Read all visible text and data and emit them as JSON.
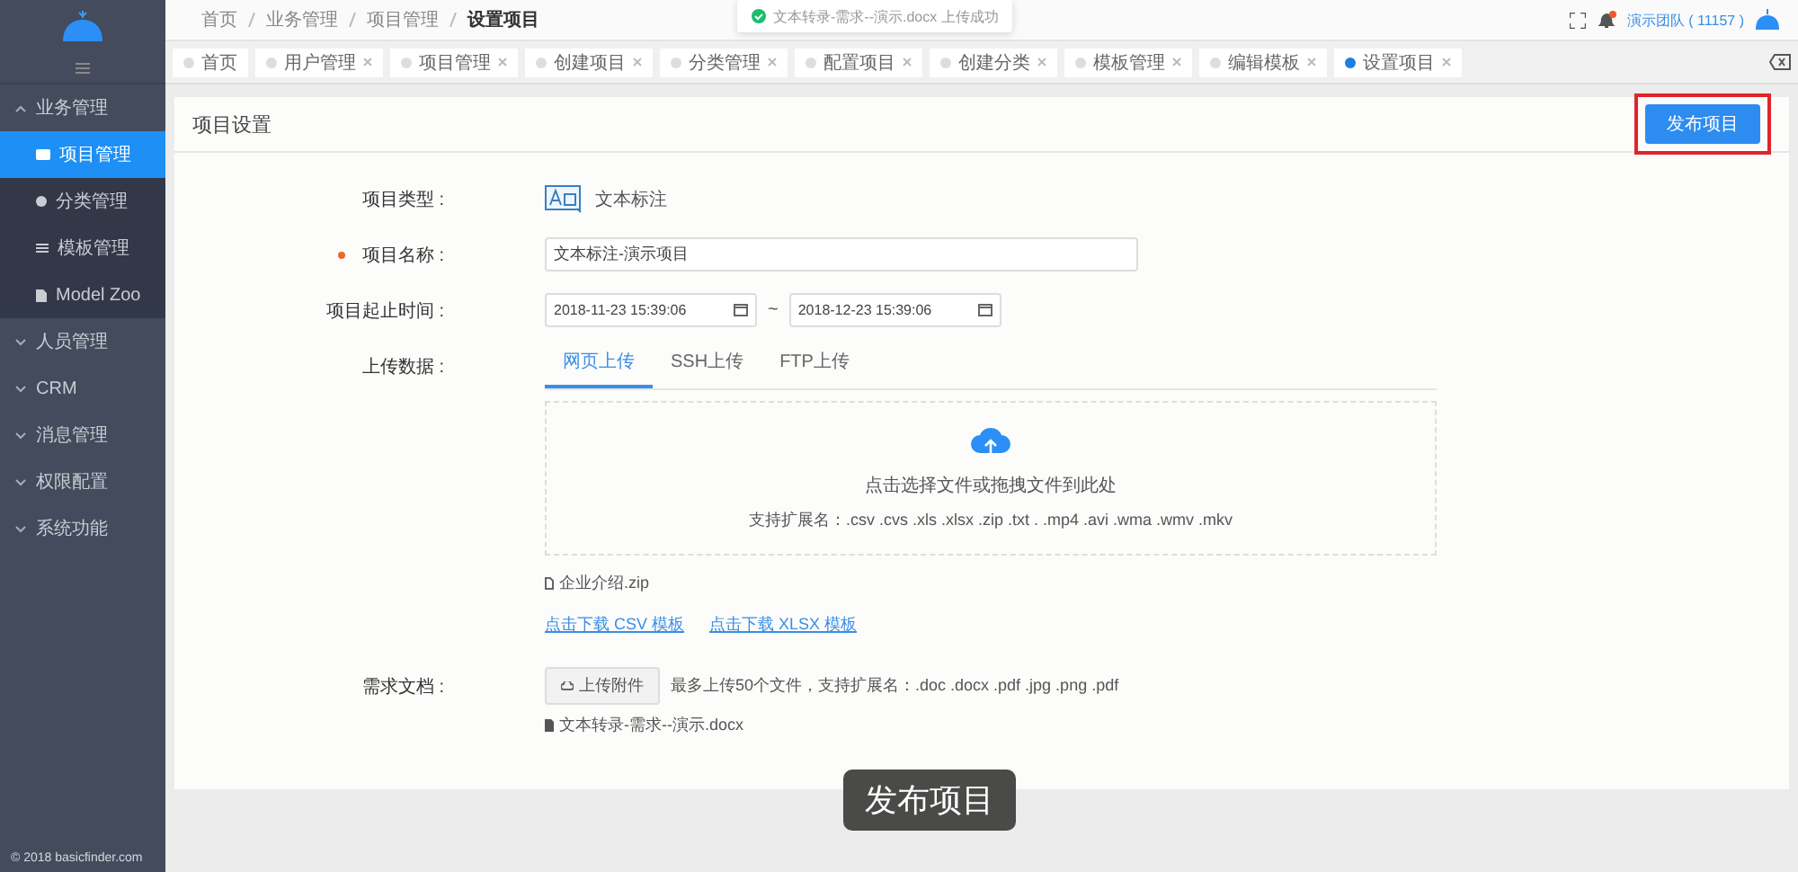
{
  "sidebar": {
    "groups": [
      {
        "label": "业务管理",
        "expanded": true,
        "children": [
          {
            "label": "项目管理",
            "kind": "card",
            "selected": true
          },
          {
            "label": "分类管理",
            "kind": "dot",
            "selected": false
          },
          {
            "label": "模板管理",
            "kind": "list",
            "selected": false
          },
          {
            "label": "Model Zoo",
            "kind": "doc",
            "selected": false
          }
        ]
      },
      {
        "label": "人员管理",
        "expanded": false
      },
      {
        "label": "CRM",
        "expanded": false
      },
      {
        "label": "消息管理",
        "expanded": false
      },
      {
        "label": "权限配置",
        "expanded": false
      },
      {
        "label": "系统功能",
        "expanded": false
      }
    ],
    "footer": "© 2018 basicfinder.com"
  },
  "breadcrumb": [
    {
      "label": "首页",
      "current": false
    },
    {
      "label": "业务管理",
      "current": false
    },
    {
      "label": "项目管理",
      "current": false
    },
    {
      "label": "设置项目",
      "current": true
    }
  ],
  "toast": {
    "text": "文本转录-需求--演示.docx 上传成功"
  },
  "header": {
    "user": "演示团队 ( 11157 )",
    "notification": true
  },
  "tabs": [
    {
      "label": "首页",
      "selected": false,
      "closable": false
    },
    {
      "label": "用户管理",
      "selected": false,
      "closable": true
    },
    {
      "label": "项目管理",
      "selected": false,
      "closable": true
    },
    {
      "label": "创建项目",
      "selected": false,
      "closable": true
    },
    {
      "label": "分类管理",
      "selected": false,
      "closable": true
    },
    {
      "label": "配置项目",
      "selected": false,
      "closable": true
    },
    {
      "label": "创建分类",
      "selected": false,
      "closable": true
    },
    {
      "label": "模板管理",
      "selected": false,
      "closable": true
    },
    {
      "label": "编辑模板",
      "selected": false,
      "closable": true
    },
    {
      "label": "设置项目",
      "selected": true,
      "closable": true
    }
  ],
  "panel": {
    "title": "项目设置",
    "publish_button": "发布项目",
    "highlighted": true
  },
  "form": {
    "type": {
      "label": "项目类型 :",
      "value": "文本标注"
    },
    "name": {
      "label": "项目名称 :",
      "required": true,
      "value": "文本标注-演示项目"
    },
    "period": {
      "label": "项目起止时间 :",
      "start": "2018-11-23 15:39:06",
      "separator": "~",
      "end": "2018-12-23 15:39:06"
    },
    "upload": {
      "label": "上传数据 :",
      "tabs": [
        {
          "label": "网页上传",
          "selected": true
        },
        {
          "label": "SSH上传",
          "selected": false
        },
        {
          "label": "FTP上传",
          "selected": false
        }
      ],
      "drop_hint": "点击选择文件或拖拽文件到此处",
      "extensions": "支持扩展名：.csv .cvs .xls .xlsx .zip .txt .  .mp4 .avi .wma .wmv .mkv",
      "file": "企业介绍.zip",
      "links": [
        "点击下载 CSV 模板",
        "点击下载 XLSX 模板"
      ]
    },
    "requirement": {
      "label": "需求文档 :",
      "button": "上传附件",
      "hint": "最多上传50个文件，支持扩展名：.doc .docx .pdf .jpg .png .pdf",
      "file": "文本转录-需求--演示.docx"
    }
  },
  "caption": "发布项目"
}
